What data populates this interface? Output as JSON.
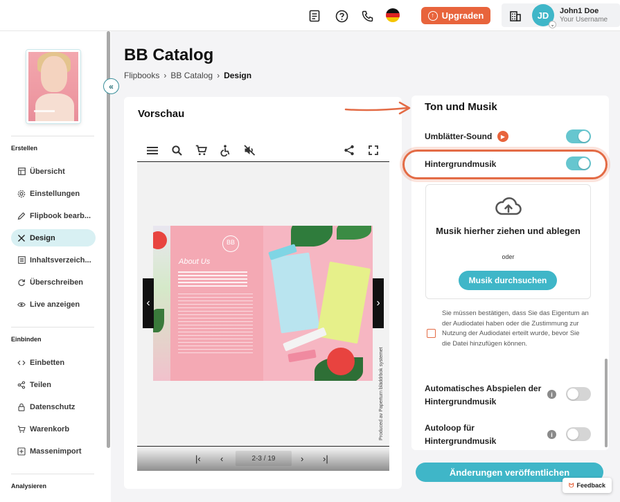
{
  "topbar": {
    "upgrade_label": "Upgraden",
    "user_name": "John1 Doe",
    "user_sub": "Your Username",
    "avatar_initials": "JD",
    "icons": [
      "document-icon",
      "help-icon",
      "phone-icon",
      "german-flag-icon",
      "building-icon"
    ]
  },
  "sidebar": {
    "sections": [
      {
        "title": "Erstellen"
      },
      {
        "title": "Einbinden"
      },
      {
        "title": "Analysieren"
      }
    ],
    "items": [
      {
        "label": "Übersicht",
        "icon": "layout-icon"
      },
      {
        "label": "Einstellungen",
        "icon": "gear-icon"
      },
      {
        "label": "Flipbook bearb...",
        "icon": "pencil-icon"
      },
      {
        "label": "Design",
        "icon": "design-tools-icon",
        "active": true
      },
      {
        "label": "Inhaltsverzeich...",
        "icon": "list-icon"
      },
      {
        "label": "Überschreiben",
        "icon": "refresh-icon"
      },
      {
        "label": "Live anzeigen",
        "icon": "eye-icon"
      },
      {
        "label": "Einbetten",
        "icon": "code-icon"
      },
      {
        "label": "Teilen",
        "icon": "share-icon"
      },
      {
        "label": "Datenschutz",
        "icon": "lock-icon"
      },
      {
        "label": "Warenkorb",
        "icon": "cart-icon"
      },
      {
        "label": "Massenimport",
        "icon": "import-icon"
      }
    ]
  },
  "header": {
    "title": "BB Catalog",
    "breadcrumb": [
      "Flipbooks",
      "BB Catalog",
      "Design"
    ]
  },
  "preview": {
    "title": "Vorschau",
    "page_indicator": "2-3 / 19",
    "produced_with": "Produced av Paperturn bläddrbok systemet",
    "book_heading": "About Us"
  },
  "settings": {
    "title": "Ton und Musik",
    "page_flip_sound": {
      "label": "Umblätter-Sound",
      "on": true
    },
    "background_music": {
      "label": "Hintergrundmusik",
      "on": true
    },
    "dropzone": {
      "text": "Musik hierher ziehen und ablegen",
      "or": "oder",
      "browse_label": "Musik durchsuchen"
    },
    "consent_text": "Sie müssen bestätigen, dass Sie das Eigentum an der Audiodatei haben oder die Zustimmung zur Nutzung der Audiodatei erteilt wurde, bevor Sie die Datei hinzufügen können.",
    "autoplay": {
      "label": "Automatisches Abspielen der Hintergrundmusik",
      "on": false
    },
    "autoloop": {
      "label": "Autoloop für Hintergrundmusik",
      "on": false
    },
    "publish_label": "Änderungen veröffentlichen",
    "feedback_label": "Feedback"
  },
  "colors": {
    "accent": "#3fb6c8",
    "brand_orange": "#e8643c",
    "toggle_on": "#66c6cf",
    "toggle_off": "#d5d5d5"
  }
}
